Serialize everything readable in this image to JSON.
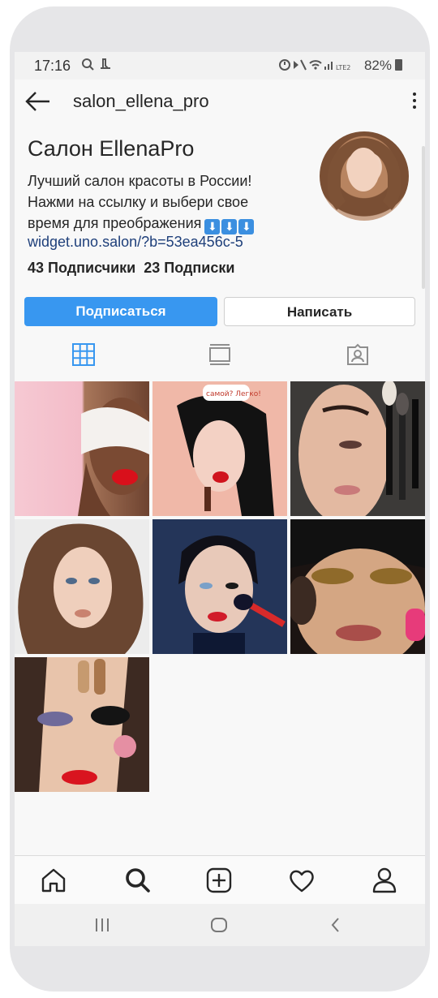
{
  "status": {
    "time": "17:16",
    "battery": "82%",
    "lte_label": "LTE2"
  },
  "header": {
    "username": "salon_ellena_pro",
    "back_icon": "arrow-left-icon",
    "menu_icon": "more-vertical-icon"
  },
  "profile": {
    "name": "Салон EllenaPro",
    "bio_line1": "Лучший салон красоты в России!",
    "bio_line2": "Нажми на ссылку и выбери свое",
    "bio_line3": "время для преображения",
    "bio_arrows": [
      "⬇",
      "⬇",
      "⬇"
    ],
    "link": "widget.uno.salon/?b=53ea456c-5",
    "followers": "43 Подписчики",
    "following": "23 Подписки"
  },
  "actions": {
    "follow_label": "Подписаться",
    "message_label": "Написать"
  },
  "tabs": [
    "grid-icon",
    "feed-icon",
    "tagged-icon"
  ],
  "grid": {
    "post_count": 7,
    "post3_caption": "самой? Легко!"
  },
  "bottom_nav": [
    "home-icon",
    "search-icon",
    "add-post-icon",
    "heart-icon",
    "profile-icon"
  ],
  "system_nav": [
    "recent-apps-icon",
    "home-button-icon",
    "back-icon"
  ],
  "colors": {
    "accent": "#3897f0",
    "link": "#1e3f7a",
    "text": "#262626"
  }
}
